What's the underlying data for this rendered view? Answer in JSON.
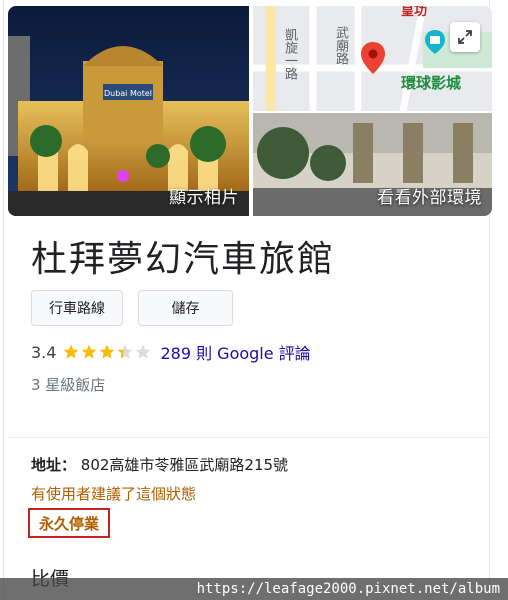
{
  "photos": {
    "main_label": "顯示相片",
    "street_label": "看看外部環境",
    "sign_text": "Dubai Motel"
  },
  "map": {
    "road_1": "凱旋一路",
    "road_2": "武廟路",
    "poi_label": "環球影城",
    "top_label": "皇功"
  },
  "place": {
    "title": "杜拜夢幻汽車旅館",
    "rating": "3.4",
    "stars": 3.4,
    "reviews_text": "289 則 Google 評論",
    "hotel_class": "3 星級飯店"
  },
  "actions": {
    "directions_label": "行車路線",
    "save_label": "儲存"
  },
  "address": {
    "label": "地址：",
    "value": "802高雄市苓雅區武廟路215號"
  },
  "status": {
    "suggest_text": "有使用者建議了這個狀態",
    "closed_text": "永久停業"
  },
  "prices": {
    "heading": "比價"
  },
  "watermark": "https://leafage2000.pixnet.net/album",
  "colors": {
    "star": "#fbbc04",
    "star_empty": "#dadce0",
    "link": "#1a0dab",
    "warning": "#b06000",
    "closed_border": "#c5221f",
    "map_pin": "#ea4335",
    "poi": "#1e8e3e"
  }
}
